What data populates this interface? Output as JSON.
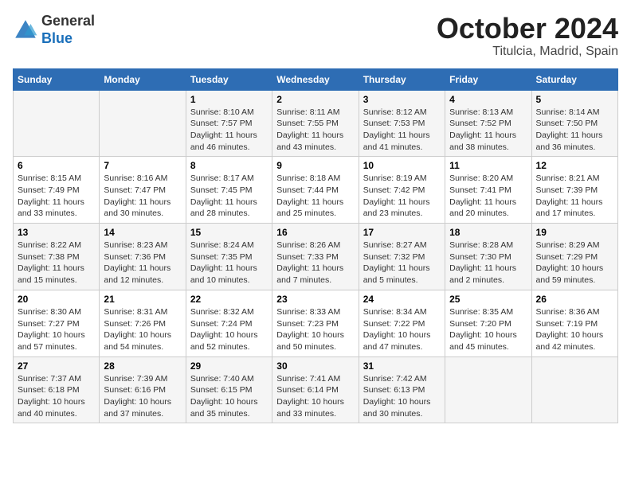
{
  "header": {
    "logo_line1": "General",
    "logo_line2": "Blue",
    "month_title": "October 2024",
    "location": "Titulcia, Madrid, Spain"
  },
  "weekdays": [
    "Sunday",
    "Monday",
    "Tuesday",
    "Wednesday",
    "Thursday",
    "Friday",
    "Saturday"
  ],
  "weeks": [
    [
      {
        "day": "",
        "detail": ""
      },
      {
        "day": "",
        "detail": ""
      },
      {
        "day": "1",
        "detail": "Sunrise: 8:10 AM\nSunset: 7:57 PM\nDaylight: 11 hours and 46 minutes."
      },
      {
        "day": "2",
        "detail": "Sunrise: 8:11 AM\nSunset: 7:55 PM\nDaylight: 11 hours and 43 minutes."
      },
      {
        "day": "3",
        "detail": "Sunrise: 8:12 AM\nSunset: 7:53 PM\nDaylight: 11 hours and 41 minutes."
      },
      {
        "day": "4",
        "detail": "Sunrise: 8:13 AM\nSunset: 7:52 PM\nDaylight: 11 hours and 38 minutes."
      },
      {
        "day": "5",
        "detail": "Sunrise: 8:14 AM\nSunset: 7:50 PM\nDaylight: 11 hours and 36 minutes."
      }
    ],
    [
      {
        "day": "6",
        "detail": "Sunrise: 8:15 AM\nSunset: 7:49 PM\nDaylight: 11 hours and 33 minutes."
      },
      {
        "day": "7",
        "detail": "Sunrise: 8:16 AM\nSunset: 7:47 PM\nDaylight: 11 hours and 30 minutes."
      },
      {
        "day": "8",
        "detail": "Sunrise: 8:17 AM\nSunset: 7:45 PM\nDaylight: 11 hours and 28 minutes."
      },
      {
        "day": "9",
        "detail": "Sunrise: 8:18 AM\nSunset: 7:44 PM\nDaylight: 11 hours and 25 minutes."
      },
      {
        "day": "10",
        "detail": "Sunrise: 8:19 AM\nSunset: 7:42 PM\nDaylight: 11 hours and 23 minutes."
      },
      {
        "day": "11",
        "detail": "Sunrise: 8:20 AM\nSunset: 7:41 PM\nDaylight: 11 hours and 20 minutes."
      },
      {
        "day": "12",
        "detail": "Sunrise: 8:21 AM\nSunset: 7:39 PM\nDaylight: 11 hours and 17 minutes."
      }
    ],
    [
      {
        "day": "13",
        "detail": "Sunrise: 8:22 AM\nSunset: 7:38 PM\nDaylight: 11 hours and 15 minutes."
      },
      {
        "day": "14",
        "detail": "Sunrise: 8:23 AM\nSunset: 7:36 PM\nDaylight: 11 hours and 12 minutes."
      },
      {
        "day": "15",
        "detail": "Sunrise: 8:24 AM\nSunset: 7:35 PM\nDaylight: 11 hours and 10 minutes."
      },
      {
        "day": "16",
        "detail": "Sunrise: 8:26 AM\nSunset: 7:33 PM\nDaylight: 11 hours and 7 minutes."
      },
      {
        "day": "17",
        "detail": "Sunrise: 8:27 AM\nSunset: 7:32 PM\nDaylight: 11 hours and 5 minutes."
      },
      {
        "day": "18",
        "detail": "Sunrise: 8:28 AM\nSunset: 7:30 PM\nDaylight: 11 hours and 2 minutes."
      },
      {
        "day": "19",
        "detail": "Sunrise: 8:29 AM\nSunset: 7:29 PM\nDaylight: 10 hours and 59 minutes."
      }
    ],
    [
      {
        "day": "20",
        "detail": "Sunrise: 8:30 AM\nSunset: 7:27 PM\nDaylight: 10 hours and 57 minutes."
      },
      {
        "day": "21",
        "detail": "Sunrise: 8:31 AM\nSunset: 7:26 PM\nDaylight: 10 hours and 54 minutes."
      },
      {
        "day": "22",
        "detail": "Sunrise: 8:32 AM\nSunset: 7:24 PM\nDaylight: 10 hours and 52 minutes."
      },
      {
        "day": "23",
        "detail": "Sunrise: 8:33 AM\nSunset: 7:23 PM\nDaylight: 10 hours and 50 minutes."
      },
      {
        "day": "24",
        "detail": "Sunrise: 8:34 AM\nSunset: 7:22 PM\nDaylight: 10 hours and 47 minutes."
      },
      {
        "day": "25",
        "detail": "Sunrise: 8:35 AM\nSunset: 7:20 PM\nDaylight: 10 hours and 45 minutes."
      },
      {
        "day": "26",
        "detail": "Sunrise: 8:36 AM\nSunset: 7:19 PM\nDaylight: 10 hours and 42 minutes."
      }
    ],
    [
      {
        "day": "27",
        "detail": "Sunrise: 7:37 AM\nSunset: 6:18 PM\nDaylight: 10 hours and 40 minutes."
      },
      {
        "day": "28",
        "detail": "Sunrise: 7:39 AM\nSunset: 6:16 PM\nDaylight: 10 hours and 37 minutes."
      },
      {
        "day": "29",
        "detail": "Sunrise: 7:40 AM\nSunset: 6:15 PM\nDaylight: 10 hours and 35 minutes."
      },
      {
        "day": "30",
        "detail": "Sunrise: 7:41 AM\nSunset: 6:14 PM\nDaylight: 10 hours and 33 minutes."
      },
      {
        "day": "31",
        "detail": "Sunrise: 7:42 AM\nSunset: 6:13 PM\nDaylight: 10 hours and 30 minutes."
      },
      {
        "day": "",
        "detail": ""
      },
      {
        "day": "",
        "detail": ""
      }
    ]
  ]
}
